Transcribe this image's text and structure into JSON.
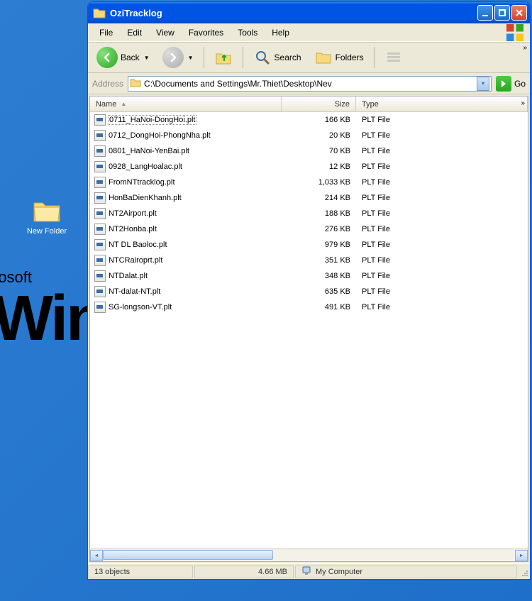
{
  "desktop": {
    "new_folder_label": "New Folder",
    "bg_rosoft": "rosoft",
    "bg_win": "Win"
  },
  "window": {
    "title": "OziTracklog"
  },
  "menu": {
    "file": "File",
    "edit": "Edit",
    "view": "View",
    "favorites": "Favorites",
    "tools": "Tools",
    "help": "Help"
  },
  "toolbar": {
    "back": "Back",
    "search": "Search",
    "folders": "Folders"
  },
  "address": {
    "label": "Address",
    "path": "C:\\Documents and Settings\\Mr.Thiet\\Desktop\\Nev",
    "go": "Go"
  },
  "columns": {
    "name": "Name",
    "size": "Size",
    "type": "Type"
  },
  "files": [
    {
      "name": "0711_HaNoi-DongHoi.plt",
      "size": "166 KB",
      "type": "PLT File",
      "selected": true
    },
    {
      "name": "0712_DongHoi-PhongNha.plt",
      "size": "20 KB",
      "type": "PLT File",
      "selected": false
    },
    {
      "name": "0801_HaNoi-YenBai.plt",
      "size": "70 KB",
      "type": "PLT File",
      "selected": false
    },
    {
      "name": "0928_LangHoalac.plt",
      "size": "12 KB",
      "type": "PLT File",
      "selected": false
    },
    {
      "name": "FromNTtracklog.plt",
      "size": "1,033 KB",
      "type": "PLT File",
      "selected": false
    },
    {
      "name": "HonBaDienKhanh.plt",
      "size": "214 KB",
      "type": "PLT File",
      "selected": false
    },
    {
      "name": "NT2Airport.plt",
      "size": "188 KB",
      "type": "PLT File",
      "selected": false
    },
    {
      "name": "NT2Honba.plt",
      "size": "276 KB",
      "type": "PLT File",
      "selected": false
    },
    {
      "name": "NT DL Baoloc.plt",
      "size": "979 KB",
      "type": "PLT File",
      "selected": false
    },
    {
      "name": "NTCRairoprt.plt",
      "size": "351 KB",
      "type": "PLT File",
      "selected": false
    },
    {
      "name": "NTDalat.plt",
      "size": "348 KB",
      "type": "PLT File",
      "selected": false
    },
    {
      "name": "NT-dalat-NT.plt",
      "size": "635 KB",
      "type": "PLT File",
      "selected": false
    },
    {
      "name": "SG-longson-VT.plt",
      "size": "491 KB",
      "type": "PLT File",
      "selected": false
    }
  ],
  "status": {
    "objects": "13 objects",
    "totalsize": "4.66 MB",
    "location": "My Computer"
  }
}
